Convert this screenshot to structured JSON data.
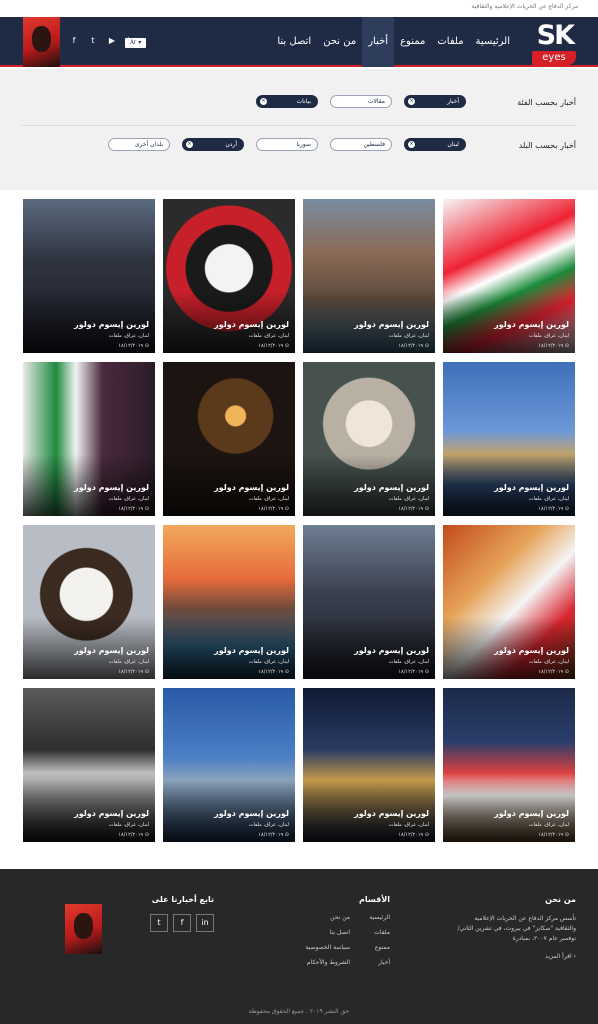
{
  "header": {
    "org_name": "مركز الدفاع عن الحريات الإعلامية والثقافية",
    "logo_top": "SK",
    "logo_bottom": "eyes",
    "menu": [
      "الرئيسية",
      "ملفات",
      "ممنوع",
      "أخبار",
      "من نحن",
      "اتصل بنا"
    ],
    "active_menu": "أخبار",
    "lang": "Ar ▾",
    "social": [
      "in",
      "▶",
      "t",
      "f"
    ]
  },
  "filters": {
    "category_label": "أخبار بحسب الفئة",
    "category_chips": [
      {
        "label": "أخبار",
        "selected": true
      },
      {
        "label": "مقالات",
        "selected": false
      },
      {
        "label": "بيانات",
        "selected": true
      }
    ],
    "country_label": "أخبار بحسب البلد",
    "country_chips": [
      {
        "label": "لبنان",
        "selected": true
      },
      {
        "label": "فلسطين",
        "selected": false
      },
      {
        "label": "سوريا",
        "selected": false
      },
      {
        "label": "أردن",
        "selected": true
      },
      {
        "label": "بلدان أخرى",
        "selected": false
      }
    ]
  },
  "articles": {
    "title": "لورين إيسوم دولور",
    "tags": "لبنان، عراق، ملفات",
    "date": "١٨/١٢/٢٠١٩ ⊙",
    "images": [
      "flag-lebanon",
      "raouche-rocks",
      "joker-protester",
      "woman-speaker",
      "beirut-hotel",
      "old-man-pipe",
      "night-protest",
      "masked-flag",
      "flag-arches",
      "woman-speaker-2",
      "raouche-sunset",
      "anonymous-mask",
      "basketball-team",
      "beirut-night",
      "beirut-coast",
      "flag-smoke"
    ]
  },
  "footer": {
    "about_title": "من نحن",
    "about_text": "تأسس مركز الدفاع عن الحريات الإعلامية والثقافية \"سكايز\" في بيروت، في تشرين الثاني/نوفمبر عام ٢٠٠٧، بمبادرة",
    "read_more": "اقرأ المزيد ›",
    "sections_title": "الأقسام",
    "links": [
      "الرئيسية",
      "من نحن",
      "ملفات",
      "اتصل بنا",
      "ممنوع",
      "سياسة الخصوصية",
      "أخبار",
      "الشروط والأحكام"
    ],
    "follow_title": "تابع أخبارنا على",
    "follow_icons": [
      "in",
      "f",
      "t"
    ],
    "copyright": "حق النشر ٢٠١٩ . جميع الحقوق محفوظة"
  }
}
